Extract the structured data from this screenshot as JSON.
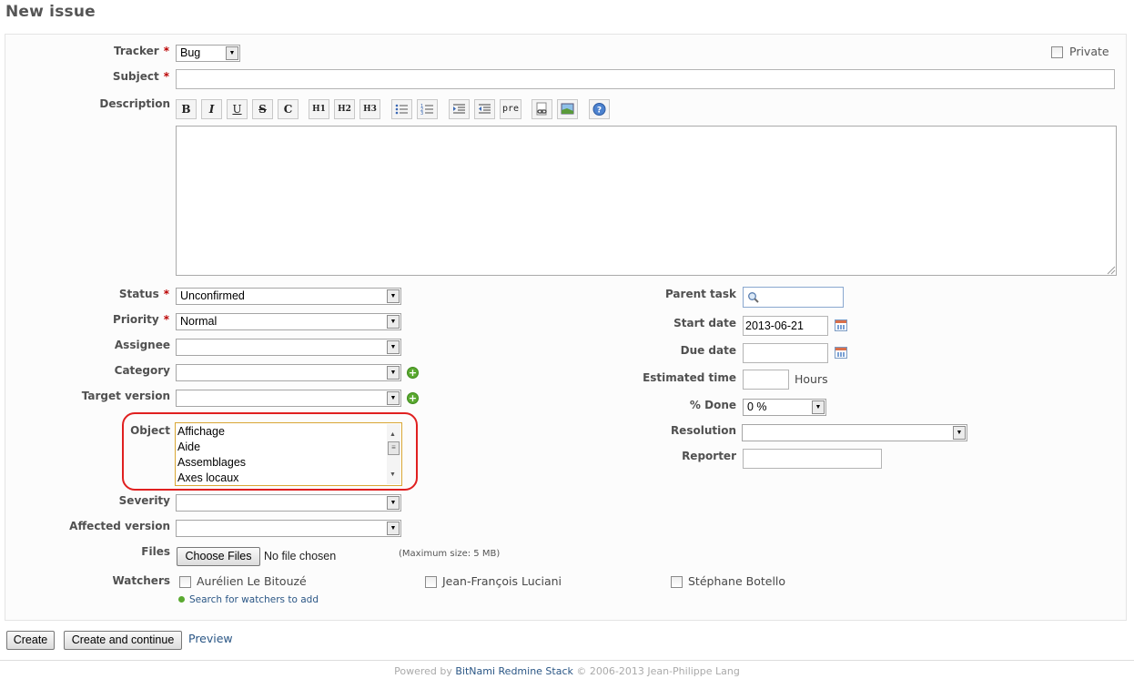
{
  "page_title": "New issue",
  "fields": {
    "tracker": {
      "label": "Tracker",
      "value": "Bug"
    },
    "private": {
      "label": "Private"
    },
    "subject": {
      "label": "Subject",
      "value": ""
    },
    "description": {
      "label": "Description",
      "value": ""
    },
    "status": {
      "label": "Status",
      "value": "Unconfirmed"
    },
    "priority": {
      "label": "Priority",
      "value": "Normal"
    },
    "assignee": {
      "label": "Assignee",
      "value": ""
    },
    "category": {
      "label": "Category",
      "value": ""
    },
    "target_version": {
      "label": "Target version",
      "value": ""
    },
    "object": {
      "label": "Object",
      "options": [
        "Affichage",
        "Aide",
        "Assemblages",
        "Axes locaux"
      ]
    },
    "severity": {
      "label": "Severity",
      "value": ""
    },
    "affected_version": {
      "label": "Affected version",
      "value": ""
    },
    "files": {
      "label": "Files",
      "button": "Choose Files",
      "status": "No file chosen",
      "max_size": "(Maximum size: 5 MB)"
    },
    "watchers": {
      "label": "Watchers",
      "users": [
        "Aurélien Le Bitouzé",
        "Jean-François Luciani",
        "Stéphane Botello"
      ],
      "search_link": "Search for watchers to add"
    },
    "parent_task": {
      "label": "Parent task",
      "value": ""
    },
    "start_date": {
      "label": "Start date",
      "value": "2013-06-21"
    },
    "due_date": {
      "label": "Due date",
      "value": ""
    },
    "estimated_time": {
      "label": "Estimated time",
      "value": "",
      "unit": "Hours"
    },
    "done_ratio": {
      "label": "% Done",
      "value": "0 %"
    },
    "resolution": {
      "label": "Resolution",
      "value": ""
    },
    "reporter": {
      "label": "Reporter",
      "value": ""
    }
  },
  "toolbar": {
    "bold": "B",
    "italic": "I",
    "underline": "U",
    "strike": "S",
    "code": "C",
    "h1": "H1",
    "h2": "H2",
    "h3": "H3",
    "pre": "pre"
  },
  "actions": {
    "create": "Create",
    "create_continue": "Create and continue",
    "preview": "Preview"
  },
  "footer": {
    "powered_by": "Powered by",
    "product": "BitNami Redmine Stack",
    "copyright": "© 2006-2013 Jean-Philippe Lang"
  },
  "colors": {
    "highlight_ring": "#e02020",
    "link": "#2a5685",
    "required": "#bb0000"
  }
}
